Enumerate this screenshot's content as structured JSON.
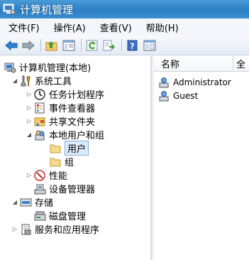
{
  "window": {
    "title": "计算机管理"
  },
  "menu": [
    {
      "label": "文件(F)"
    },
    {
      "label": "操作(A)"
    },
    {
      "label": "查看(V)"
    },
    {
      "label": "帮助(H)"
    }
  ],
  "toolbar": {
    "buttons": [
      "back-icon",
      "forward-icon",
      "up-folder-icon",
      "show-hide-tree-icon",
      "refresh-icon",
      "export-list-icon",
      "help-icon",
      "properties-icon"
    ]
  },
  "tree": {
    "root": "计算机管理(本地)",
    "system_tools": "系统工具",
    "task_scheduler": "任务计划程序",
    "event_viewer": "事件查看器",
    "shared_folders": "共享文件夹",
    "local_users_groups": "本地用户和组",
    "users": "用户",
    "groups": "组",
    "performance": "性能",
    "device_manager": "设备管理器",
    "storage": "存储",
    "disk_management": "磁盘管理",
    "services_apps": "服务和应用程序"
  },
  "list": {
    "columns": [
      "名称",
      "全"
    ],
    "rows": [
      {
        "name": "Administrator"
      },
      {
        "name": "Guest"
      }
    ]
  }
}
